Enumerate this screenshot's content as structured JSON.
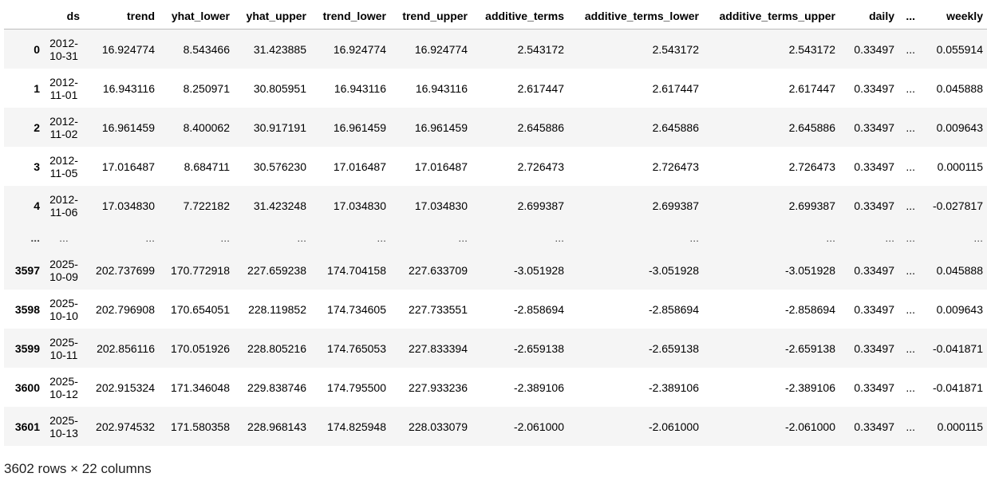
{
  "table": {
    "index_header": "",
    "columns": [
      "ds",
      "trend",
      "yhat_lower",
      "yhat_upper",
      "trend_lower",
      "trend_upper",
      "additive_terms",
      "additive_terms_lower",
      "additive_terms_upper",
      "daily",
      "...",
      "weekly"
    ],
    "rows": [
      {
        "index": "0",
        "ds": [
          "2012-",
          "10-31"
        ],
        "cells": [
          "16.924774",
          "8.543466",
          "31.423885",
          "16.924774",
          "16.924774",
          "2.543172",
          "2.543172",
          "2.543172",
          "0.33497",
          "...",
          "0.055914"
        ]
      },
      {
        "index": "1",
        "ds": [
          "2012-",
          "11-01"
        ],
        "cells": [
          "16.943116",
          "8.250971",
          "30.805951",
          "16.943116",
          "16.943116",
          "2.617447",
          "2.617447",
          "2.617447",
          "0.33497",
          "...",
          "0.045888"
        ]
      },
      {
        "index": "2",
        "ds": [
          "2012-",
          "11-02"
        ],
        "cells": [
          "16.961459",
          "8.400062",
          "30.917191",
          "16.961459",
          "16.961459",
          "2.645886",
          "2.645886",
          "2.645886",
          "0.33497",
          "...",
          "0.009643"
        ]
      },
      {
        "index": "3",
        "ds": [
          "2012-",
          "11-05"
        ],
        "cells": [
          "17.016487",
          "8.684711",
          "30.576230",
          "17.016487",
          "17.016487",
          "2.726473",
          "2.726473",
          "2.726473",
          "0.33497",
          "...",
          "0.000115"
        ]
      },
      {
        "index": "4",
        "ds": [
          "2012-",
          "11-06"
        ],
        "cells": [
          "17.034830",
          "7.722182",
          "31.423248",
          "17.034830",
          "17.034830",
          "2.699387",
          "2.699387",
          "2.699387",
          "0.33497",
          "...",
          "-0.027817"
        ]
      },
      {
        "index": "...",
        "ds": [
          "..."
        ],
        "cells": [
          "...",
          "...",
          "...",
          "...",
          "...",
          "...",
          "...",
          "...",
          "...",
          "...",
          "..."
        ],
        "ellipsis": true
      },
      {
        "index": "3597",
        "ds": [
          "2025-",
          "10-09"
        ],
        "cells": [
          "202.737699",
          "170.772918",
          "227.659238",
          "174.704158",
          "227.633709",
          "-3.051928",
          "-3.051928",
          "-3.051928",
          "0.33497",
          "...",
          "0.045888"
        ]
      },
      {
        "index": "3598",
        "ds": [
          "2025-",
          "10-10"
        ],
        "cells": [
          "202.796908",
          "170.654051",
          "228.119852",
          "174.734605",
          "227.733551",
          "-2.858694",
          "-2.858694",
          "-2.858694",
          "0.33497",
          "...",
          "0.009643"
        ]
      },
      {
        "index": "3599",
        "ds": [
          "2025-",
          "10-11"
        ],
        "cells": [
          "202.856116",
          "170.051926",
          "228.805216",
          "174.765053",
          "227.833394",
          "-2.659138",
          "-2.659138",
          "-2.659138",
          "0.33497",
          "...",
          "-0.041871"
        ]
      },
      {
        "index": "3600",
        "ds": [
          "2025-",
          "10-12"
        ],
        "cells": [
          "202.915324",
          "171.346048",
          "229.838746",
          "174.795500",
          "227.933236",
          "-2.389106",
          "-2.389106",
          "-2.389106",
          "0.33497",
          "...",
          "-0.041871"
        ]
      },
      {
        "index": "3601",
        "ds": [
          "2025-",
          "10-13"
        ],
        "cells": [
          "202.974532",
          "171.580358",
          "228.968143",
          "174.825948",
          "228.033079",
          "-2.061000",
          "-2.061000",
          "-2.061000",
          "0.33497",
          "...",
          "0.000115"
        ]
      }
    ]
  },
  "footer": {
    "shape_text": "3602 rows × 22 columns"
  }
}
